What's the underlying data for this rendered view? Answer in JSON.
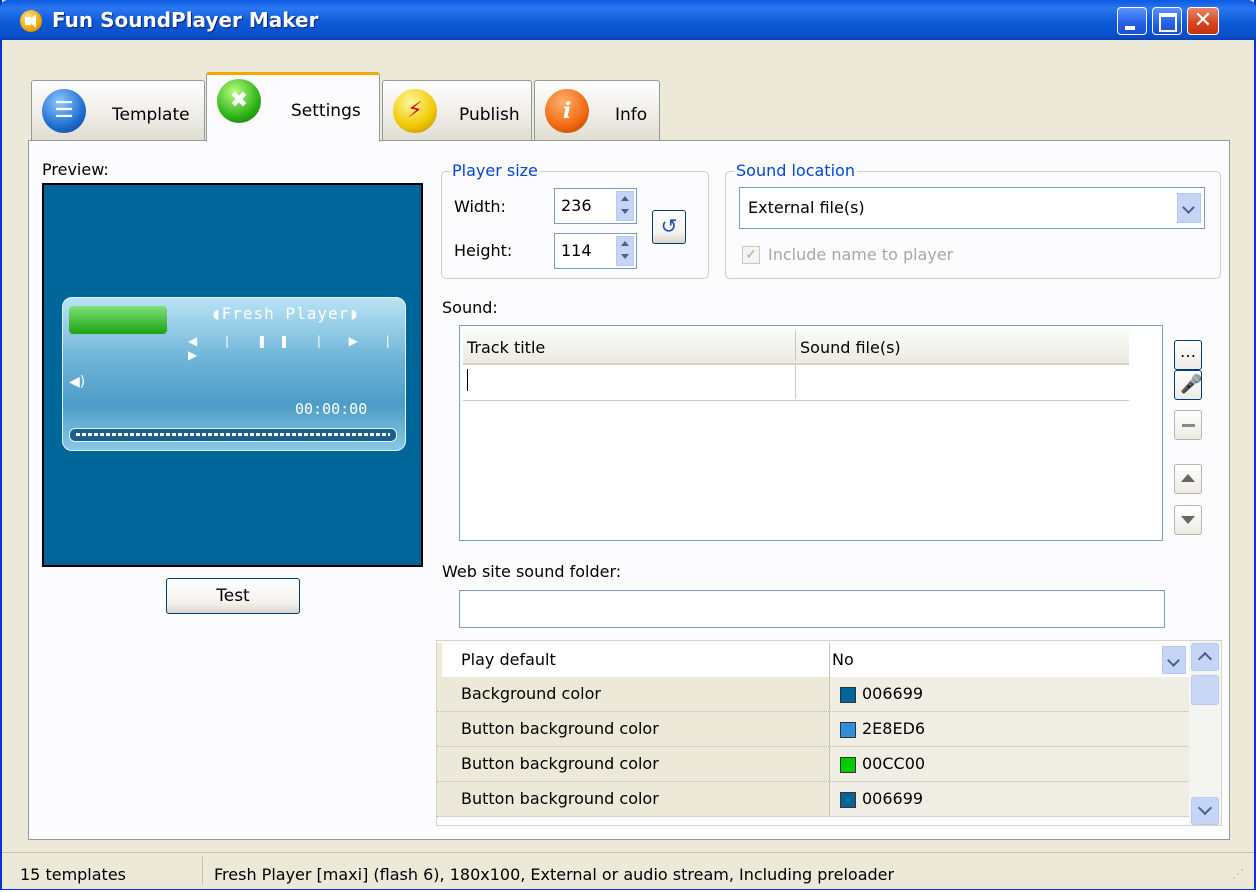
{
  "window": {
    "title": "Fun SoundPlayer Maker"
  },
  "tabs": [
    {
      "label": "Template",
      "icon": "list-icon"
    },
    {
      "label": "Settings",
      "icon": "tools-icon"
    },
    {
      "label": "Publish",
      "icon": "flash-icon"
    },
    {
      "label": "Info",
      "icon": "info-icon"
    }
  ],
  "preview": {
    "label": "Preview:",
    "background_color": "#006699",
    "player_name": "◖Fresh Player◗",
    "time": "00:00:00",
    "test_button": "Test"
  },
  "player_size": {
    "title": "Player size",
    "width_label": "Width:",
    "width_value": "236",
    "height_label": "Height:",
    "height_value": "114"
  },
  "sound_location": {
    "title": "Sound location",
    "selected": "External file(s)",
    "include_name_label": "Include name to player",
    "include_name_checked": true
  },
  "sound": {
    "label": "Sound:",
    "columns": [
      "Track title",
      "Sound file(s)"
    ],
    "rows": [
      [
        "",
        ""
      ]
    ]
  },
  "web_folder": {
    "label": "Web site sound folder:",
    "value": ""
  },
  "properties": [
    {
      "label": "Play default",
      "value": "No",
      "color": null
    },
    {
      "label": "Background color",
      "value": "006699",
      "color": "#006699"
    },
    {
      "label": "Button background color",
      "value": "2E8ED6",
      "color": "#2E8ED6"
    },
    {
      "label": "Button background color",
      "value": "00CC00",
      "color": "#00CC00"
    },
    {
      "label": "Button background color",
      "value": "006699",
      "color": "#006699"
    }
  ],
  "status": {
    "templates": "15 templates",
    "info": "Fresh Player [maxi] (flash 6), 180x100, External or audio stream, Including preloader"
  }
}
